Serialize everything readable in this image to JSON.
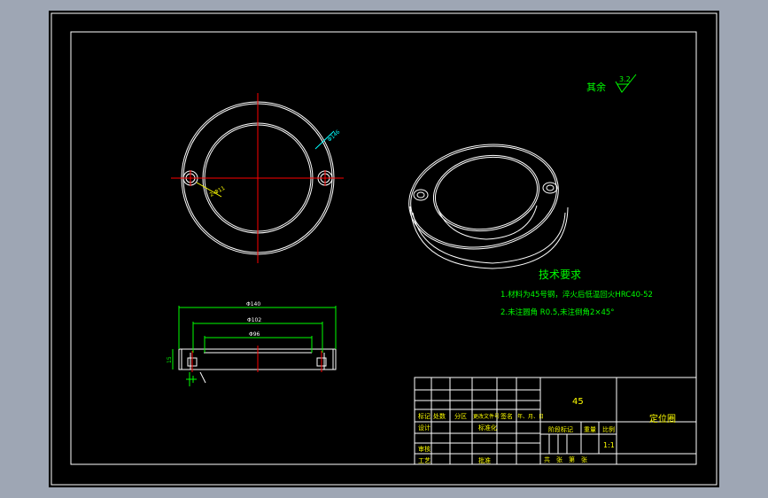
{
  "surface_finish": {
    "prefix": "其余",
    "value": "3.2"
  },
  "technical_requirements": {
    "title": "技术要求",
    "items": [
      "1.材料为45号钢，淬火后低温回火HRC40-52",
      "2.未注圆角 R0.5,未注倒角2×45°"
    ]
  },
  "plan_view_callouts": {
    "outer_diameter": "Φ146",
    "hole": "2-Φ11"
  },
  "section_view_dims": {
    "outer": "Φ140",
    "middle": "Φ102",
    "inner": "Φ96",
    "height": "15"
  },
  "title_block": {
    "material": "45",
    "part_name": "定位圈",
    "scale": "1:1",
    "row_labels": [
      "标记",
      "处数",
      "分区",
      "更改文件号",
      "签名",
      "年、月、日"
    ],
    "designer_label": "设计",
    "standardization_label": "标准化",
    "stage_mark_label": "阶段标记",
    "weight_label": "重量",
    "scale_label": "比例",
    "checker_label": "审核",
    "process_label": "工艺",
    "approval_label": "批准",
    "sheet_label": "共　张　第　张"
  },
  "colors": {
    "background": "#000000",
    "geometry": "#ffffff",
    "centerline": "#ff0000",
    "dimension": "#00ff00",
    "annotation": "#00ff00",
    "callout": "#00ffff",
    "title_text": "#ffff00",
    "window_chrome": "#9ea6b4"
  }
}
